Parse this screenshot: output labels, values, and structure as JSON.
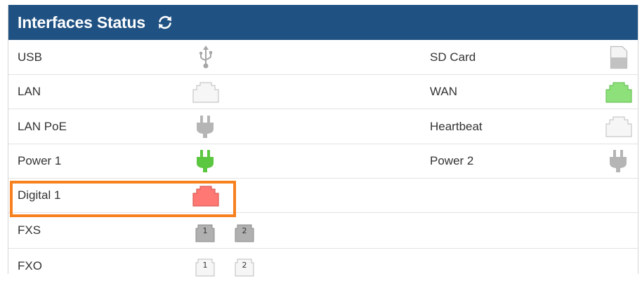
{
  "header": {
    "title": "Interfaces Status",
    "refresh_icon": "refresh-icon"
  },
  "rows": [
    {
      "left": {
        "label": "USB",
        "icon": "usb-icon",
        "state": "inactive"
      },
      "right": {
        "label": "SD Card",
        "icon": "sd-card-icon",
        "state": "inactive"
      }
    },
    {
      "left": {
        "label": "LAN",
        "icon": "ethernet-port-icon",
        "state": "disconnected"
      },
      "right": {
        "label": "WAN",
        "icon": "ethernet-port-icon",
        "state": "connected"
      }
    },
    {
      "left": {
        "label": "LAN PoE",
        "icon": "power-plug-icon",
        "state": "inactive"
      },
      "right": {
        "label": "Heartbeat",
        "icon": "ethernet-port-icon",
        "state": "disconnected"
      }
    },
    {
      "left": {
        "label": "Power 1",
        "icon": "power-plug-icon",
        "state": "connected"
      },
      "right": {
        "label": "Power 2",
        "icon": "power-plug-icon",
        "state": "inactive"
      }
    },
    {
      "left": {
        "label": "Digital 1",
        "icon": "ethernet-port-icon",
        "state": "error"
      }
    },
    {
      "left": {
        "label": "FXS",
        "ports": [
          {
            "icon": "phone-port-icon",
            "number": "1"
          },
          {
            "icon": "phone-port-icon",
            "number": "2"
          }
        ],
        "state": "inactive"
      }
    },
    {
      "left": {
        "label": "FXO",
        "ports": [
          {
            "icon": "phone-port-icon",
            "number": "1"
          },
          {
            "icon": "phone-port-icon",
            "number": "2"
          }
        ],
        "state": "disconnected"
      }
    }
  ],
  "colors": {
    "header_bg": "#1f5182",
    "connected": "#8ee07a",
    "error": "#ff7873",
    "inactive": "#b5b5b5",
    "disconnected": "#f4f4f4",
    "highlight": "#f7801f"
  }
}
